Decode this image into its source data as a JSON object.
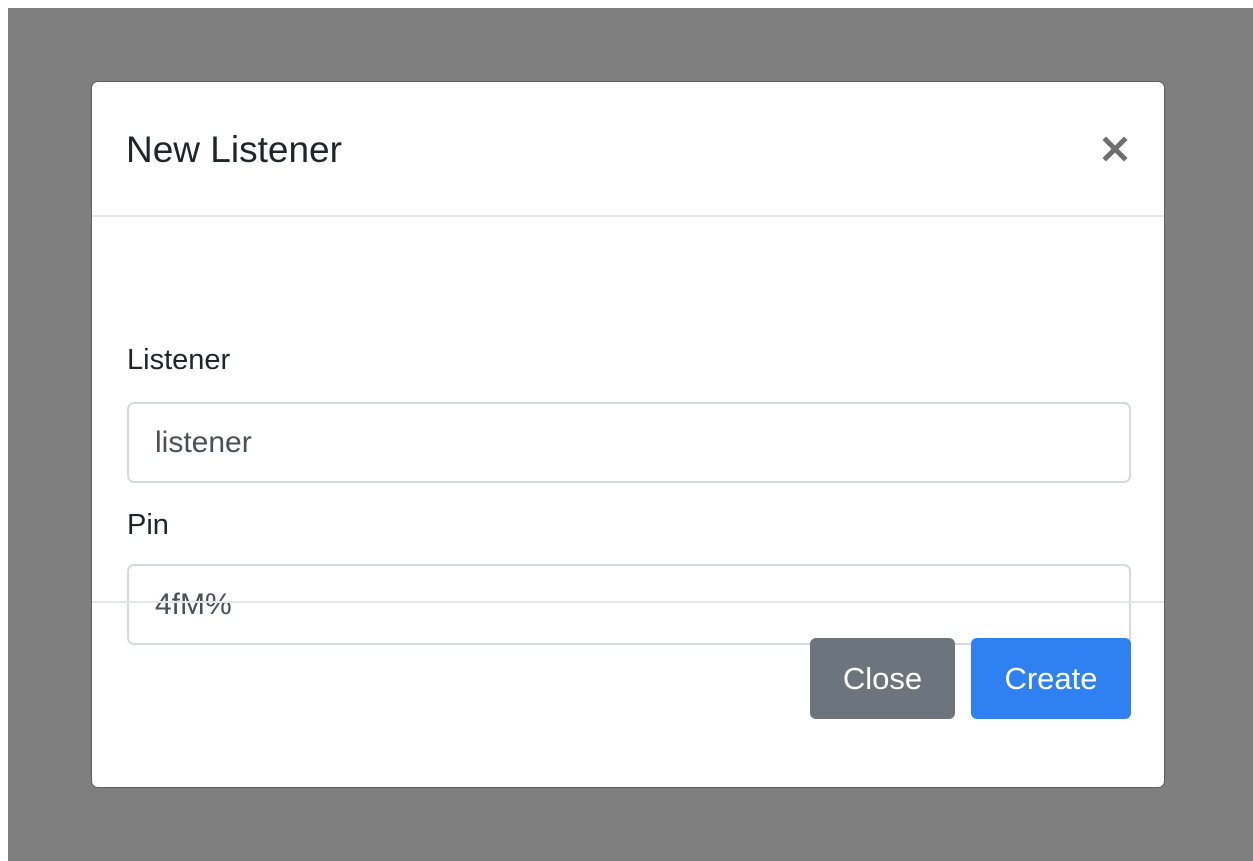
{
  "modal": {
    "title": "New Listener",
    "close_icon": "close-icon"
  },
  "form": {
    "listener": {
      "label": "Listener",
      "value": "listener"
    },
    "pin": {
      "label": "Pin",
      "value": "4fM%"
    }
  },
  "footer": {
    "close_label": "Close",
    "create_label": "Create"
  },
  "colors": {
    "backdrop": "#7f7f7f",
    "secondary_button": "#6c757d",
    "primary_button": "#2f80f0",
    "text": "#212529"
  }
}
